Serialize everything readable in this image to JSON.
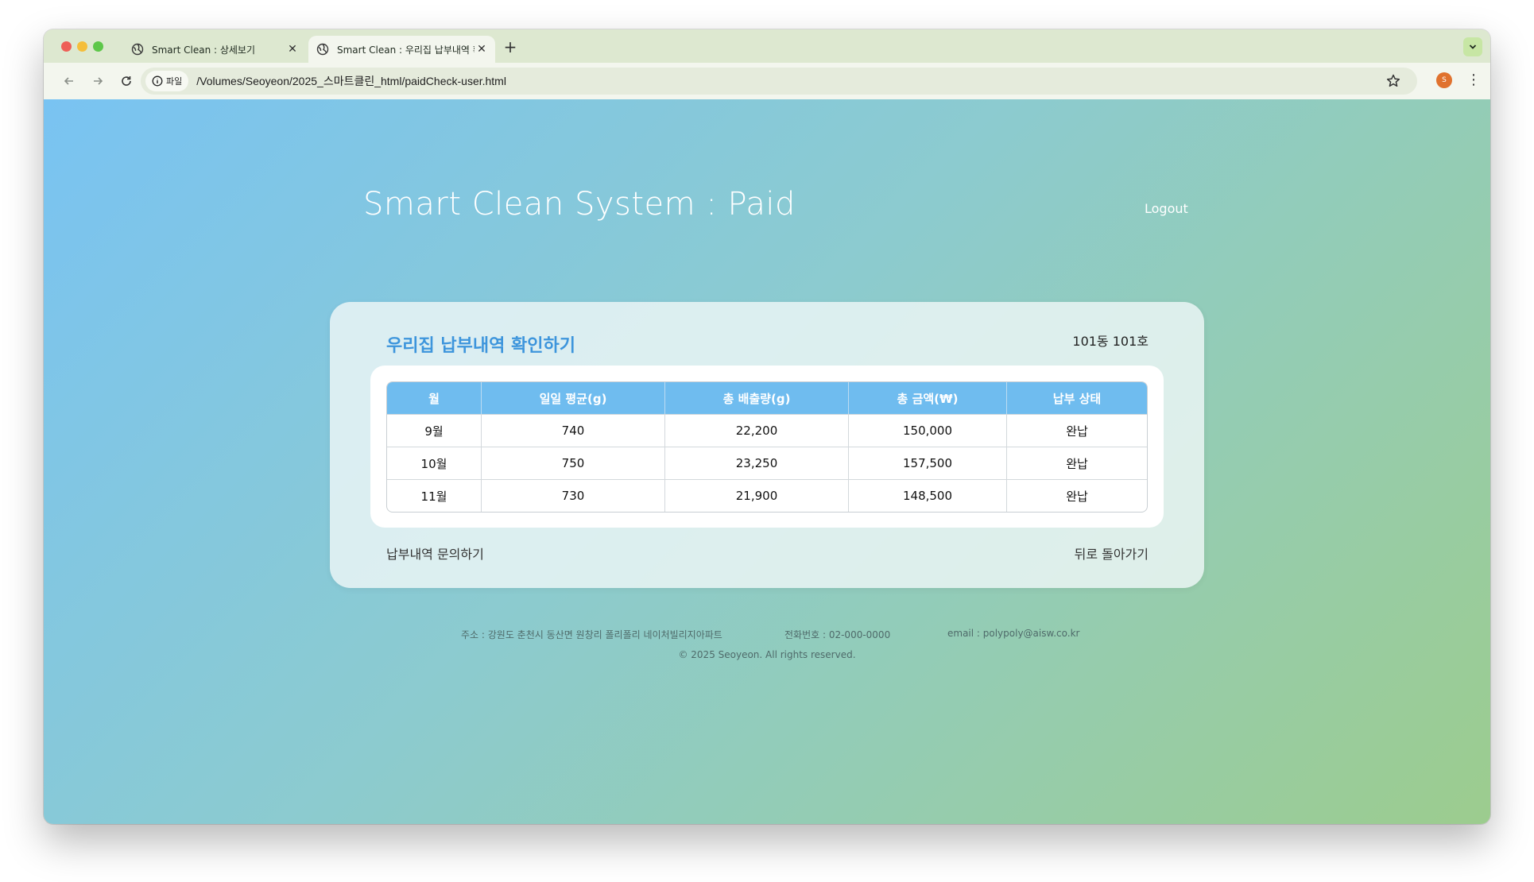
{
  "browser": {
    "tabs": [
      {
        "title": "Smart Clean : 상세보기",
        "active": false
      },
      {
        "title": "Smart Clean : 우리집 납부내역 확",
        "active": true
      }
    ],
    "address": {
      "chip_label": "파일",
      "url": "/Volumes/Seoyeon/2025_스마트클린_html/paidCheck-user.html"
    },
    "profile_initial": "S"
  },
  "header": {
    "title": "Smart Clean System : Paid",
    "logout_label": "Logout"
  },
  "card": {
    "title": "우리집 납부내역 확인하기",
    "unit": "101동 101호",
    "table": {
      "headers": [
        "월",
        "일일 평균(g)",
        "총 배출량(g)",
        "총 금액(₩)",
        "납부 상태"
      ],
      "rows": [
        [
          "9월",
          "740",
          "22,200",
          "150,000",
          "완납"
        ],
        [
          "10월",
          "750",
          "23,250",
          "157,500",
          "완납"
        ],
        [
          "11월",
          "730",
          "21,900",
          "148,500",
          "완납"
        ]
      ]
    },
    "inquiry_link": "납부내역 문의하기",
    "back_link": "뒤로 돌아가기"
  },
  "footer": {
    "address": "주소 : 강원도 춘천시 동산면 원창리 폴리폴리 네이처빌리지아파트",
    "phone": "전화번호 : 02-000-0000",
    "email": "email : polypoly@aisw.co.kr",
    "copyright": "© 2025 Seoyeon. All rights reserved."
  },
  "colors": {
    "accent": "#3d95dc",
    "table_header": "#6fbcef",
    "gradient_start": "#79c3f2",
    "gradient_end": "#9ccc8e"
  }
}
